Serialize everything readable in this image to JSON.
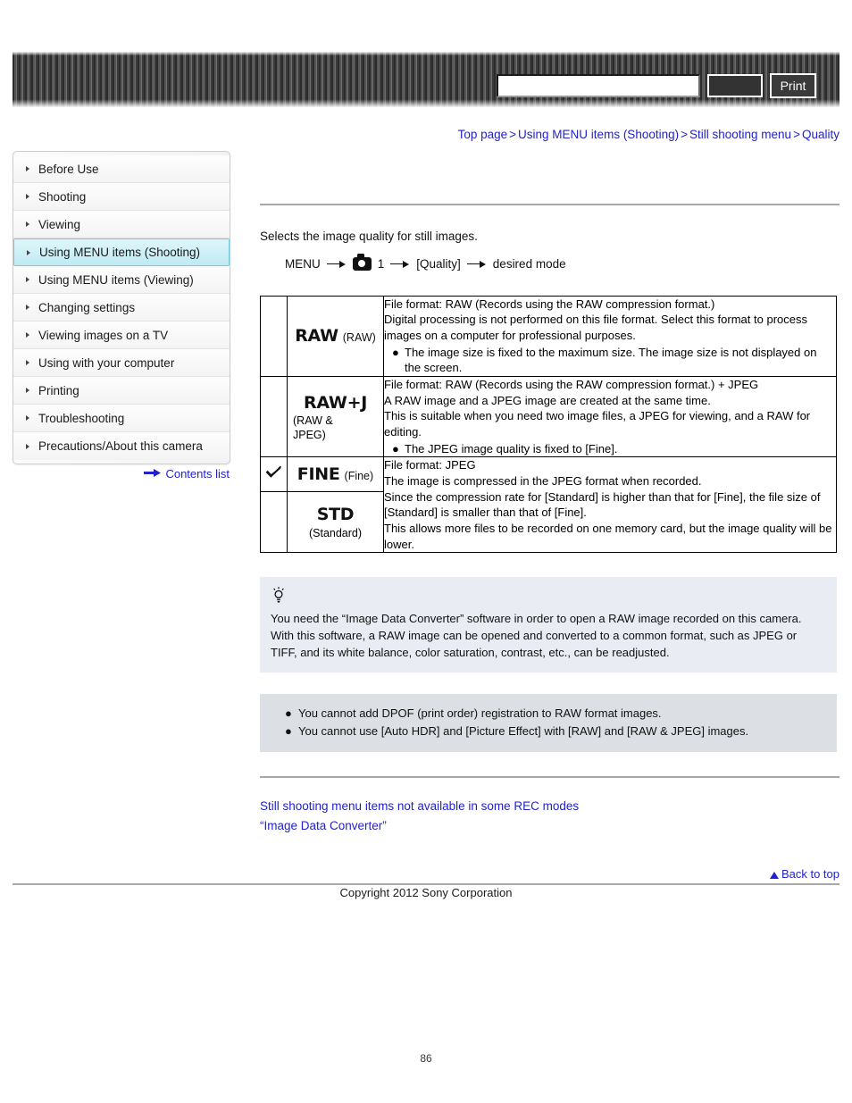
{
  "header": {
    "search_value": "",
    "search_placeholder": "",
    "search_button_label": "",
    "print_button_label": "Print"
  },
  "breadcrumb": {
    "items": [
      "Top page",
      "Using MENU items (Shooting)",
      "Still shooting menu",
      "Quality"
    ],
    "separator": ">"
  },
  "sidebar": {
    "items": [
      {
        "label": "Before Use",
        "active": false
      },
      {
        "label": "Shooting",
        "active": false
      },
      {
        "label": "Viewing",
        "active": false
      },
      {
        "label": "Using MENU items (Shooting)",
        "active": true
      },
      {
        "label": "Using MENU items (Viewing)",
        "active": false
      },
      {
        "label": "Changing settings",
        "active": false
      },
      {
        "label": "Viewing images on a TV",
        "active": false
      },
      {
        "label": "Using with your computer",
        "active": false
      },
      {
        "label": "Printing",
        "active": false
      },
      {
        "label": "Troubleshooting",
        "active": false
      },
      {
        "label": "Precautions/About this camera",
        "active": false
      }
    ],
    "contents_list_label": "Contents list"
  },
  "main": {
    "intro": "Selects the image quality for still images.",
    "menu_path": {
      "start": "MENU",
      "camera_number": "1",
      "item": "[Quality]",
      "end": "desired mode"
    },
    "table": {
      "rows": [
        {
          "checked": false,
          "icon_big": "RAW",
          "icon_suffix": "(RAW)",
          "icon_layout": "inline",
          "lines": [
            "File format: RAW (Records using the RAW compression format.)",
            "Digital processing is not performed on this file format. Select this format to process images on a computer for professional purposes."
          ],
          "bullets": [
            "The image size is fixed to the maximum size. The image size is not displayed on the screen."
          ]
        },
        {
          "checked": false,
          "icon_big": "RAW+J",
          "icon_sub_line1": "(RAW &",
          "icon_sub_line2": "JPEG)",
          "icon_layout": "stacked",
          "lines": [
            "File format: RAW (Records using the RAW compression format.) + JPEG",
            "A RAW image and a JPEG image are created at the same time.",
            "This is suitable when you need two image files, a JPEG for viewing, and a RAW for editing."
          ],
          "bullets": [
            "The JPEG image quality is fixed to [Fine]."
          ]
        }
      ],
      "merged_group": {
        "fine": {
          "checked": true,
          "icon_big": "FINE",
          "icon_suffix": "(Fine)"
        },
        "std": {
          "checked": false,
          "icon_big": "STD",
          "icon_sub": "(Standard)"
        },
        "lines": [
          "File format: JPEG",
          "The image is compressed in the JPEG format when recorded.",
          "Since the compression rate for [Standard] is higher than that for [Fine], the file size of [Standard] is smaller than that of [Fine].",
          "This allows more files to be recorded on one memory card, but the image quality will be lower."
        ]
      }
    },
    "tip": {
      "text": "You need the “Image Data Converter” software in order to open a RAW image recorded on this camera. With this software, a RAW image can be opened and converted to a common format, such as JPEG or TIFF, and its white balance, color saturation, contrast, etc., can be readjusted."
    },
    "notes": [
      "You cannot add DPOF (print order) registration to RAW format images.",
      "You cannot use [Auto HDR] and [Picture Effect] with [RAW] and [RAW & JPEG] images."
    ],
    "related_links": [
      "Still shooting menu items not available in some REC modes",
      "“Image Data Converter”"
    ]
  },
  "footer": {
    "back_to_top": "Back to top",
    "copyright": "Copyright 2012 Sony Corporation",
    "page_number": "86"
  },
  "colors": {
    "link": "#2222cc",
    "tip_bg": "#e9edf3",
    "note_bg": "#dcdfe3",
    "active_nav": "#bfeaf4"
  }
}
